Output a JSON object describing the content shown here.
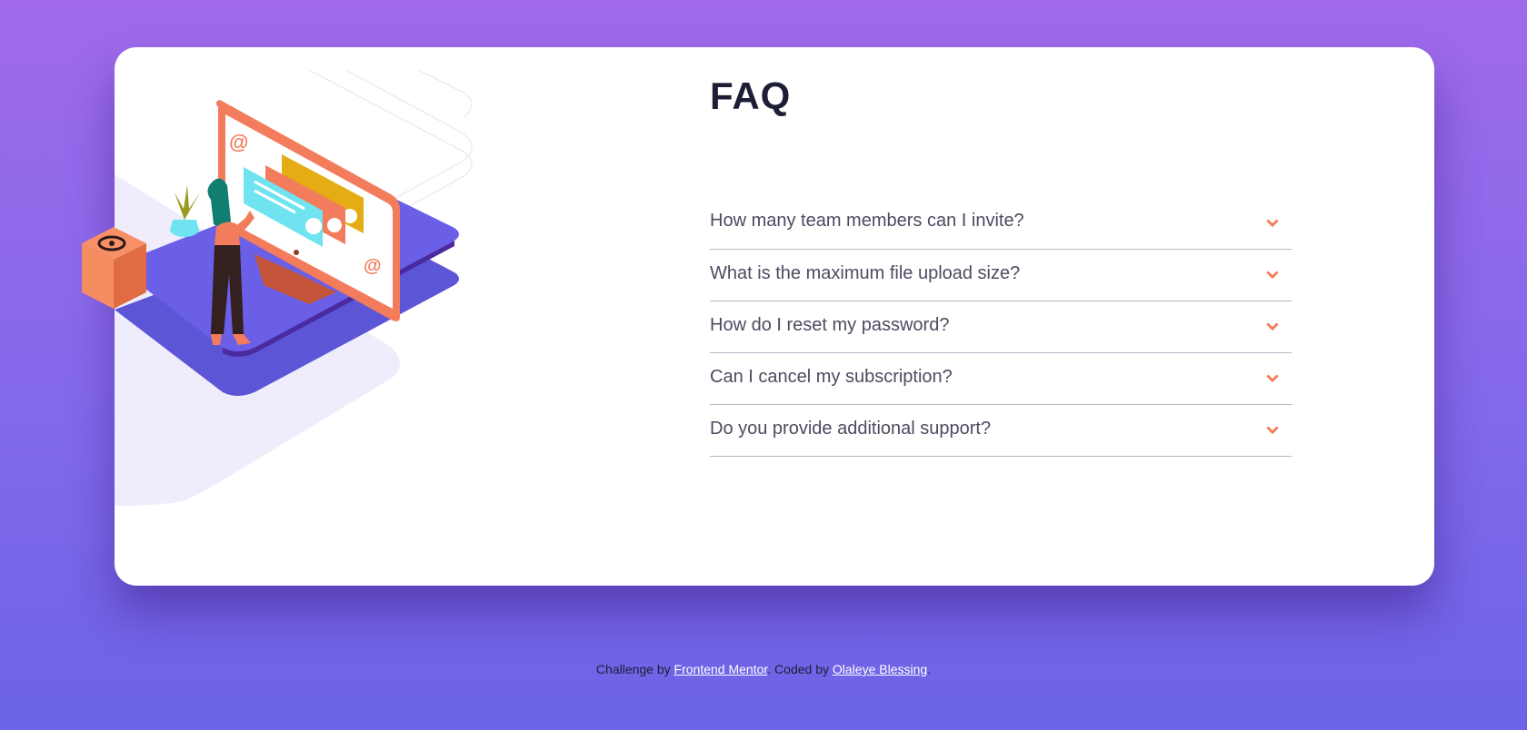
{
  "faq": {
    "title": "FAQ",
    "items": [
      {
        "question": "How many team members can I invite?"
      },
      {
        "question": "What is the maximum file upload size?"
      },
      {
        "question": "How do I reset my password?"
      },
      {
        "question": "Can I cancel my subscription?"
      },
      {
        "question": "Do you provide additional support?"
      }
    ]
  },
  "footer": {
    "challenge_prefix": "Challenge by ",
    "challenge_link": "Frontend Mentor",
    "separator": ". Coded by ",
    "author_link": "Olaleye Blessing",
    "suffix": "."
  },
  "colors": {
    "accent": "#f47c57",
    "title": "#1d1e35",
    "text": "#4b4c5f",
    "divider": "#b9b5c7",
    "bg_top": "#a06aeb",
    "bg_bottom": "#6c63e6"
  },
  "icons": {
    "chevron": "chevron-down-icon",
    "box_symbol": "at-sign-icon"
  }
}
